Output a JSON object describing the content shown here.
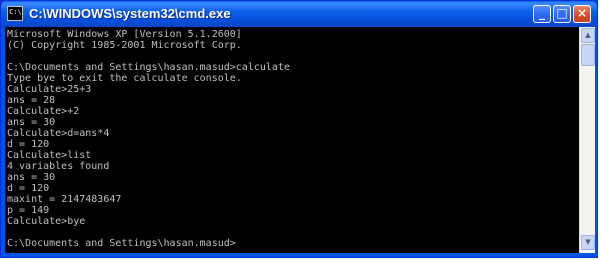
{
  "window": {
    "title": "C:\\WINDOWS\\system32\\cmd.exe",
    "icon_label": "C:\\",
    "controls": {
      "minimize": "_",
      "maximize": "□",
      "close": "×"
    }
  },
  "console": {
    "text": "Microsoft Windows XP [Version 5.1.2600]\n(C) Copyright 1985-2001 Microsoft Corp.\n\nC:\\Documents and Settings\\hasan.masud>calculate\nType bye to exit the calculate console.\nCalculate>25+3\nans = 28\nCalculate>+2\nans = 30\nCalculate>d=ans*4\nd = 120\nCalculate>list\n4 variables found\nans = 30\nd = 120\nmaxint = 2147483647\np = 149\nCalculate>bye\n\nC:\\Documents and Settings\\hasan.masud>"
  },
  "scrollbar": {
    "up": "▲",
    "down": "▼"
  },
  "colors": {
    "titlebar": "#0054e3",
    "console_bg": "#000000",
    "console_fg": "#c0c0c0"
  }
}
